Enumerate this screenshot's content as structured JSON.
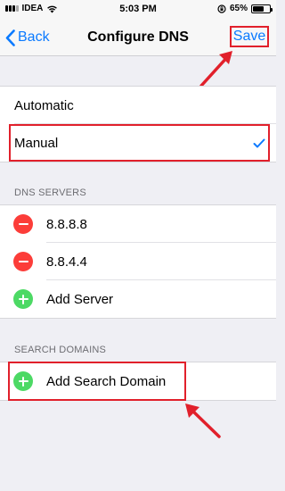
{
  "status_bar": {
    "carrier": "IDEA",
    "time": "5:03 PM",
    "battery_percent": "65%",
    "battery_level": 0.65,
    "icons": [
      "signal-icon",
      "wifi-icon",
      "rotation-lock-icon",
      "battery-icon"
    ]
  },
  "nav": {
    "back_label": "Back",
    "title": "Configure DNS",
    "save_label": "Save"
  },
  "mode_options": [
    {
      "label": "Automatic",
      "selected": false
    },
    {
      "label": "Manual",
      "selected": true
    }
  ],
  "dns_servers": {
    "header": "DNS SERVERS",
    "items": [
      "8.8.8.8",
      "8.8.4.4"
    ],
    "add_label": "Add Server"
  },
  "search_domains": {
    "header": "SEARCH DOMAINS",
    "add_label": "Add Search Domain"
  },
  "colors": {
    "accent": "#0a7aff",
    "highlight": "#e1202b",
    "delete": "#fc3d39",
    "add": "#4cd964"
  }
}
